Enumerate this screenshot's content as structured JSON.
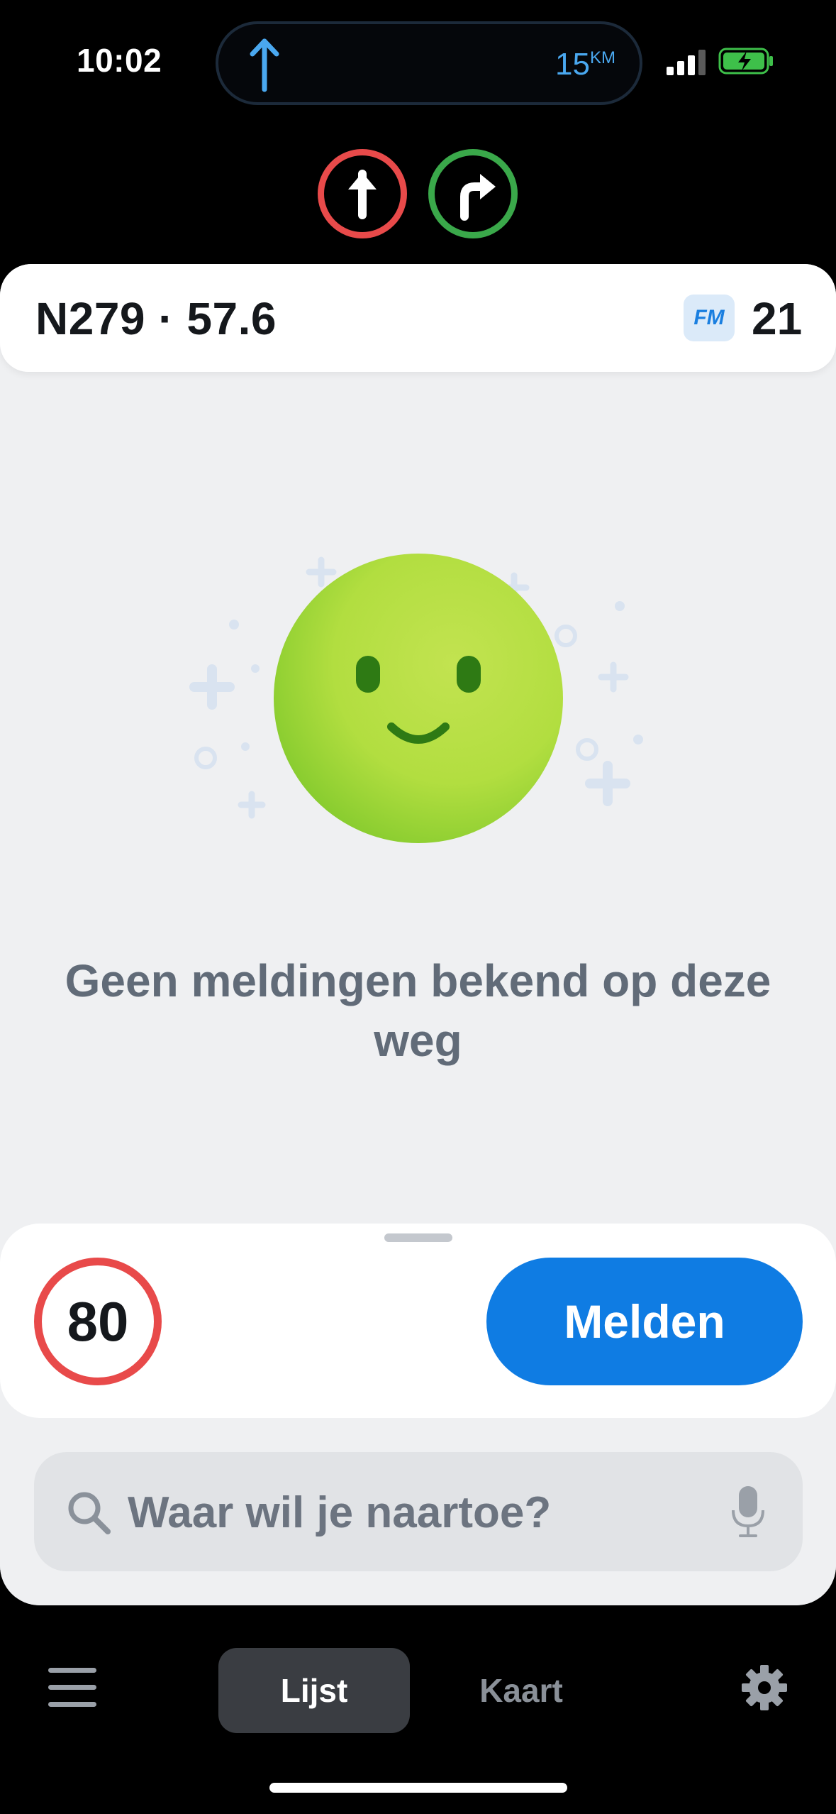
{
  "status_bar": {
    "time": "10:02",
    "nav_distance": "15",
    "nav_distance_unit": "KM",
    "nav_arrow_icon": "arrow-up-icon",
    "signal_icon": "cellular-signal-icon",
    "battery_icon": "battery-charging-icon"
  },
  "lanes": [
    {
      "icon": "arrow-straight-icon",
      "color": "#e84a4a"
    },
    {
      "icon": "arrow-turn-right-icon",
      "color": "#3aa84a"
    }
  ],
  "road": {
    "name": "N279 · 57.6",
    "fm_badge": "FM",
    "fm_count": "21"
  },
  "empty_state": {
    "illustration_icon": "smiley-face-icon",
    "message": "Geen meldingen bekend op deze weg"
  },
  "sheet": {
    "speed_limit": "80",
    "report_button": "Melden",
    "search_placeholder": "Waar wil je naartoe?"
  },
  "bottom_nav": {
    "menu_icon": "hamburger-menu-icon",
    "tabs": [
      {
        "label": "Lijst",
        "active": true
      },
      {
        "label": "Kaart",
        "active": false
      }
    ],
    "settings_icon": "gear-icon"
  },
  "colors": {
    "accent": "#0f7ce3",
    "speed_sign_border": "#e84a4a",
    "smiley": "#b8e04a"
  }
}
